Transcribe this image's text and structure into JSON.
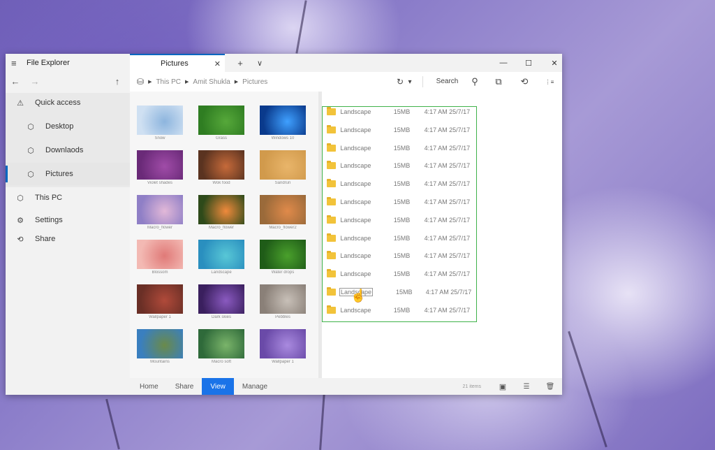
{
  "window": {
    "app_title": "File Explorer",
    "active_tab": "Pictures",
    "new_tab_symbol": "+",
    "tab_menu_symbol": "∨",
    "minimize_symbol": "—",
    "maximize_symbol": "☐",
    "close_symbol": "✕"
  },
  "sidebar": {
    "menu_icon": "≡",
    "back_icon": "←",
    "forward_icon": "→",
    "up_icon": "↑",
    "items": [
      {
        "label": "Quick access",
        "icon": "⚠"
      },
      {
        "label": "Desktop",
        "icon": "⬡"
      },
      {
        "label": "Downlaods",
        "icon": "⬡"
      },
      {
        "label": "Pictures",
        "icon": "⬡"
      },
      {
        "label": "This PC",
        "icon": "⬡"
      },
      {
        "label": "Settings",
        "icon": "⚙"
      },
      {
        "label": "Share",
        "icon": "⟲"
      }
    ]
  },
  "address": {
    "crumbs": [
      "This PC",
      "Amit Shukla",
      "Pictures"
    ],
    "search_placeholder": "Search",
    "refresh_icon": "↻",
    "dropdown_icon": "▾",
    "search_icon": "⚲",
    "view_icon": "⧉",
    "share_icon": "⟲",
    "more_icon": "⋮≡"
  },
  "thumbnails": [
    {
      "caption": "Snow",
      "color": "#cfe0f2",
      "accent": "#8db5de"
    },
    {
      "caption": "Grass",
      "color": "#2f7d22",
      "accent": "#56a83a"
    },
    {
      "caption": "Windows 10",
      "color": "#0a3a8c",
      "accent": "#3fa0ff"
    },
    {
      "caption": "Violet shades",
      "color": "#6a2a78",
      "accent": "#a04ca8"
    },
    {
      "caption": "Wok food",
      "color": "#5a3320",
      "accent": "#c66a3a"
    },
    {
      "caption": "Sandrun",
      "color": "#d19a4c",
      "accent": "#e9b56a"
    },
    {
      "caption": "Macro_flower",
      "color": "#8f7fc6",
      "accent": "#e2b8d8"
    },
    {
      "caption": "Macro_flower",
      "color": "#2e4a1a",
      "accent": "#f08a3c"
    },
    {
      "caption": "Macro_flower2",
      "color": "#9a6a3a",
      "accent": "#e08a4a"
    },
    {
      "caption": "Blossom",
      "color": "#f3b9b3",
      "accent": "#e07a78"
    },
    {
      "caption": "Landscape",
      "color": "#2a8fbf",
      "accent": "#58c7d6"
    },
    {
      "caption": "Water drops",
      "color": "#1f5c18",
      "accent": "#4aa02c"
    },
    {
      "caption": "Wallpaper 1",
      "color": "#6a2f26",
      "accent": "#b04a3a"
    },
    {
      "caption": "Dark skies",
      "color": "#3a1f5e",
      "accent": "#8a5ac0"
    },
    {
      "caption": "Pebbles",
      "color": "#8a8078",
      "accent": "#c8c0b8"
    },
    {
      "caption": "Mountains",
      "color": "#3a7fbf",
      "accent": "#6a8a4a"
    },
    {
      "caption": "Macro soft",
      "color": "#2f6a3a",
      "accent": "#7ab46a"
    },
    {
      "caption": "Wallpaper 1",
      "color": "#6a4aa8",
      "accent": "#a98adf"
    }
  ],
  "files": [
    {
      "name": "Landscape",
      "size": "15MB",
      "date": "4:17 AM 25/7/17"
    },
    {
      "name": "Landscape",
      "size": "15MB",
      "date": "4:17 AM 25/7/17"
    },
    {
      "name": "Landscape",
      "size": "15MB",
      "date": "4:17 AM 25/7/17"
    },
    {
      "name": "Landscape",
      "size": "15MB",
      "date": "4:17 AM 25/7/17"
    },
    {
      "name": "Landscape",
      "size": "15MB",
      "date": "4:17 AM 25/7/17"
    },
    {
      "name": "Landscape",
      "size": "15MB",
      "date": "4:17 AM 25/7/17"
    },
    {
      "name": "Landscape",
      "size": "15MB",
      "date": "4:17 AM 25/7/17"
    },
    {
      "name": "Landscape",
      "size": "15MB",
      "date": "4:17 AM 25/7/17"
    },
    {
      "name": "Landscape",
      "size": "15MB",
      "date": "4:17 AM 25/7/17"
    },
    {
      "name": "Landscape",
      "size": "15MB",
      "date": "4:17 AM 25/7/17"
    },
    {
      "name": "Landscape",
      "size": "15MB",
      "date": "4:17 AM 25/7/17"
    },
    {
      "name": "Landscape",
      "size": "15MB",
      "date": "4:17 AM 25/7/17"
    }
  ],
  "bottom": {
    "tabs": [
      "Home",
      "Share",
      "View",
      "Manage"
    ],
    "active_tab_index": 2,
    "item_count": "21 items",
    "image_icon": "▣",
    "list_icon": "☰",
    "delete_icon": "🗑"
  },
  "colors": {
    "accent": "#0067c0",
    "selection_border": "#3fb24a",
    "active_tab_bg": "#1a73e8"
  },
  "cursor_icon": "☝"
}
